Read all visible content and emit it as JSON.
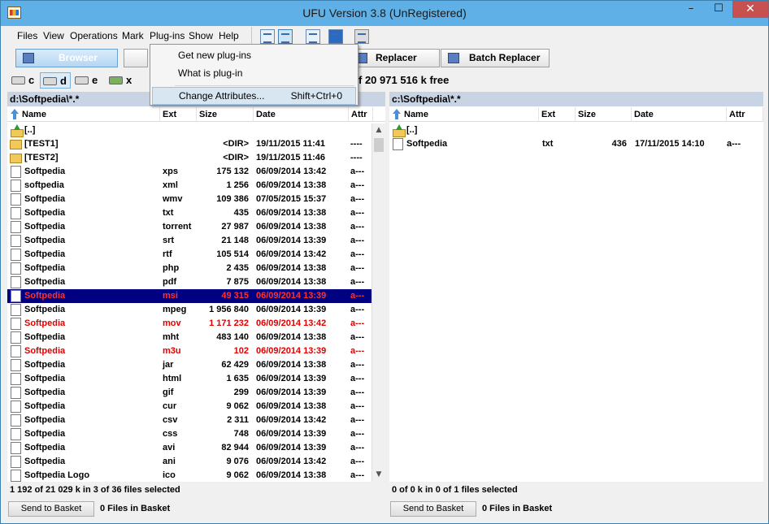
{
  "window": {
    "title": "UFU Version 3.8 (UnRegistered)",
    "minimize": "–",
    "maximize": "☐",
    "close": "✕"
  },
  "menu": {
    "files": "Files",
    "view": "View",
    "operations": "Operations",
    "mark": "Mark",
    "plugins": "Plug-ins",
    "show": "Show",
    "help": "Help"
  },
  "plugins_menu": {
    "get_new": "Get new plug-ins",
    "what_is": "What is plug-in",
    "change_attributes": "Change Attributes...",
    "change_attributes_shortcut": "Shift+Ctrl+0"
  },
  "modes": {
    "browser": "Browser",
    "replacer": "Replacer",
    "batch_replacer": "Batch Replacer"
  },
  "drives": [
    "c",
    "d",
    "e",
    "x"
  ],
  "free_space": "f 20 971 516 k free",
  "columns": {
    "name": "Name",
    "ext": "Ext",
    "size": "Size",
    "date": "Date",
    "attr": "Attr"
  },
  "left_panel": {
    "path": "d:\\Softpedia\\*.*",
    "rows": [
      {
        "name": "[..]",
        "ext": "",
        "size": "",
        "date": "",
        "attr": "",
        "kind": "up"
      },
      {
        "name": "[TEST1]",
        "ext": "",
        "size": "<DIR>",
        "date": "19/11/2015 11:41",
        "attr": "----",
        "kind": "folder"
      },
      {
        "name": "[TEST2]",
        "ext": "",
        "size": "<DIR>",
        "date": "19/11/2015 11:46",
        "attr": "----",
        "kind": "folder"
      },
      {
        "name": "Softpedia",
        "ext": "xps",
        "size": "175 132",
        "date": "06/09/2014 13:42",
        "attr": "a---",
        "kind": "file"
      },
      {
        "name": "softpedia",
        "ext": "xml",
        "size": "1 256",
        "date": "06/09/2014 13:38",
        "attr": "a---",
        "kind": "file"
      },
      {
        "name": "Softpedia",
        "ext": "wmv",
        "size": "109 386",
        "date": "07/05/2015 15:37",
        "attr": "a---",
        "kind": "file"
      },
      {
        "name": "Softpedia",
        "ext": "txt",
        "size": "435",
        "date": "06/09/2014 13:38",
        "attr": "a---",
        "kind": "file"
      },
      {
        "name": "Softpedia",
        "ext": "torrent",
        "size": "27 987",
        "date": "06/09/2014 13:38",
        "attr": "a---",
        "kind": "file"
      },
      {
        "name": "Softpedia",
        "ext": "srt",
        "size": "21 148",
        "date": "06/09/2014 13:39",
        "attr": "a---",
        "kind": "file"
      },
      {
        "name": "Softpedia",
        "ext": "rtf",
        "size": "105 514",
        "date": "06/09/2014 13:42",
        "attr": "a---",
        "kind": "file"
      },
      {
        "name": "Softpedia",
        "ext": "php",
        "size": "2 435",
        "date": "06/09/2014 13:38",
        "attr": "a---",
        "kind": "file"
      },
      {
        "name": "Softpedia",
        "ext": "pdf",
        "size": "7 875",
        "date": "06/09/2014 13:38",
        "attr": "a---",
        "kind": "file"
      },
      {
        "name": "Softpedia",
        "ext": "msi",
        "size": "49 315",
        "date": "06/09/2014 13:39",
        "attr": "a---",
        "kind": "file",
        "state": "selected"
      },
      {
        "name": "Softpedia",
        "ext": "mpeg",
        "size": "1 956 840",
        "date": "06/09/2014 13:39",
        "attr": "a---",
        "kind": "file"
      },
      {
        "name": "Softpedia",
        "ext": "mov",
        "size": "1 171 232",
        "date": "06/09/2014 13:42",
        "attr": "a---",
        "kind": "file",
        "state": "marked"
      },
      {
        "name": "Softpedia",
        "ext": "mht",
        "size": "483 140",
        "date": "06/09/2014 13:38",
        "attr": "a---",
        "kind": "file"
      },
      {
        "name": "Softpedia",
        "ext": "m3u",
        "size": "102",
        "date": "06/09/2014 13:39",
        "attr": "a---",
        "kind": "file",
        "state": "marked"
      },
      {
        "name": "Softpedia",
        "ext": "jar",
        "size": "62 429",
        "date": "06/09/2014 13:38",
        "attr": "a---",
        "kind": "file"
      },
      {
        "name": "Softpedia",
        "ext": "html",
        "size": "1 635",
        "date": "06/09/2014 13:39",
        "attr": "a---",
        "kind": "file"
      },
      {
        "name": "Softpedia",
        "ext": "gif",
        "size": "299",
        "date": "06/09/2014 13:39",
        "attr": "a---",
        "kind": "file"
      },
      {
        "name": "Softpedia",
        "ext": "cur",
        "size": "9 062",
        "date": "06/09/2014 13:38",
        "attr": "a---",
        "kind": "file"
      },
      {
        "name": "Softpedia",
        "ext": "csv",
        "size": "2 311",
        "date": "06/09/2014 13:42",
        "attr": "a---",
        "kind": "file"
      },
      {
        "name": "Softpedia",
        "ext": "css",
        "size": "748",
        "date": "06/09/2014 13:39",
        "attr": "a---",
        "kind": "file"
      },
      {
        "name": "Softpedia",
        "ext": "avi",
        "size": "82 944",
        "date": "06/09/2014 13:39",
        "attr": "a---",
        "kind": "file"
      },
      {
        "name": "Softpedia",
        "ext": "ani",
        "size": "9 076",
        "date": "06/09/2014 13:42",
        "attr": "a---",
        "kind": "file"
      },
      {
        "name": "Softpedia Logo",
        "ext": "ico",
        "size": "9 062",
        "date": "06/09/2014 13:38",
        "attr": "a---",
        "kind": "file"
      }
    ],
    "status": "1 192 of 21 029 k in 3 of 36 files selected",
    "basket_button": "Send to Basket",
    "basket_count": "0 Files in Basket"
  },
  "right_panel": {
    "path": "c:\\Softpedia\\*.*",
    "rows": [
      {
        "name": "[..]",
        "ext": "",
        "size": "",
        "date": "",
        "attr": "",
        "kind": "up"
      },
      {
        "name": "Softpedia",
        "ext": "txt",
        "size": "436",
        "date": "17/11/2015 14:10",
        "attr": "a---",
        "kind": "file"
      }
    ],
    "status": "0 of 0 k in 0 of 1 files selected",
    "basket_button": "Send to Basket",
    "basket_count": "0 Files in Basket"
  }
}
